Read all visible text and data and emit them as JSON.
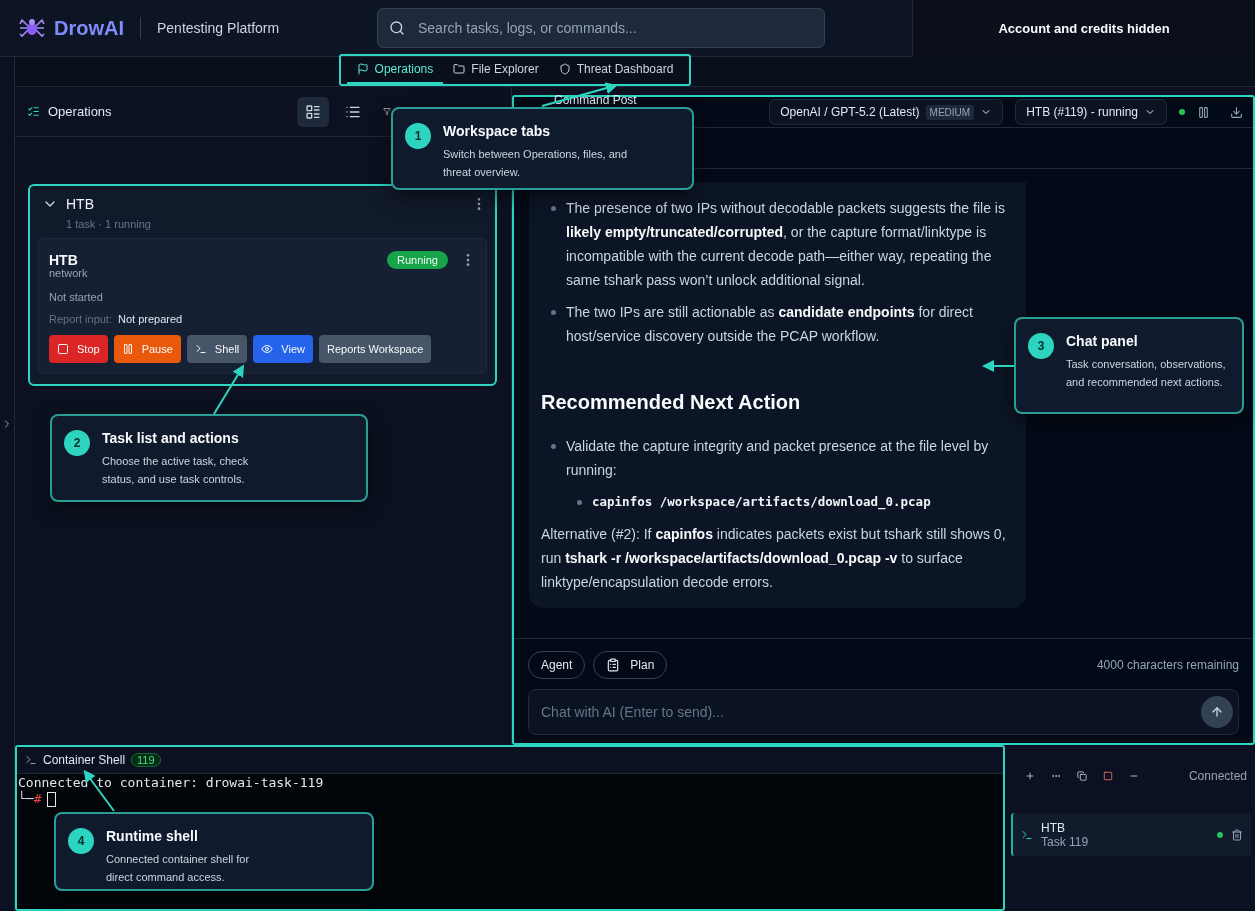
{
  "header": {
    "logo": "DrowAI",
    "subtitle": "Pentesting Platform",
    "search": {
      "placeholder": "Search tasks, logs, or commands..."
    },
    "account": "Account and credits hidden"
  },
  "tabs": [
    {
      "kind": "operations",
      "label": "Operations",
      "selected": true
    },
    {
      "kind": "files",
      "label": "File Explorer",
      "selected": false
    },
    {
      "kind": "threats",
      "label": "Threat Dashboard",
      "selected": false
    }
  ],
  "operations": {
    "title": "Operations",
    "views": [
      {
        "kind": "cards",
        "selected": true
      },
      {
        "kind": "list",
        "selected": false
      }
    ],
    "groups": [
      {
        "name": "HTB",
        "expanded": true,
        "summary": "1 task · 1 running",
        "tasks": [
          {
            "name": "HTB",
            "type": "network",
            "status": "Running",
            "progress": "Not started",
            "report_label": "Report input:",
            "report_value": "Not prepared",
            "actions": [
              {
                "kind": "stop",
                "label": "Stop"
              },
              {
                "kind": "pause",
                "label": "Pause"
              },
              {
                "kind": "shell",
                "label": "Shell"
              },
              {
                "kind": "view",
                "label": "View"
              },
              {
                "kind": "reports",
                "label": "Reports Workspace"
              }
            ]
          }
        ]
      }
    ]
  },
  "chat": {
    "title": "Command Post",
    "model": "OpenAI / GPT-5.2 (Latest)",
    "effort": "MEDIUM",
    "task_select": "HTB (#119) - running",
    "connected": true,
    "blocks": [
      {
        "kind": "bullet",
        "text": "The presence of two IPs without decodable packets suggests the file is **likely empty/truncated/corrupted**, or the capture format/linktype is incompatible with the current decode path—either way, repeating the same tshark pass won’t unlock additional signal."
      },
      {
        "kind": "bullet",
        "text": "The two IPs are still actionable as **candidate endpoints** for direct host/service discovery outside the PCAP workflow."
      },
      {
        "kind": "heading",
        "text": "Recommended Next Action"
      },
      {
        "kind": "bullet",
        "text": "Validate the capture integrity and packet presence at the file level by running:"
      },
      {
        "kind": "code_bullet",
        "text": "capinfos /workspace/artifacts/download_0.pcap"
      },
      {
        "kind": "paragraph",
        "text": "Alternative (#2): If **capinfos** indicates packets exist but tshark still shows 0, run **tshark -r /workspace/artifacts/download_0.pcap -v** to surface linktype/encapsulation decode errors."
      }
    ],
    "modes": [
      {
        "kind": "agent",
        "label": "Agent"
      },
      {
        "kind": "plan",
        "label": "Plan"
      }
    ],
    "remaining": "4000 characters remaining",
    "input": {
      "placeholder": "Chat with AI (Enter to send)..."
    }
  },
  "shell": {
    "title": "Container Shell",
    "badge": "119",
    "lines": [
      "Connected to container: drowai-task-119"
    ],
    "prompt": "└─#",
    "status": "Connected",
    "sessions": [
      {
        "name": "HTB",
        "detail": "Task 119",
        "selected": true,
        "connected": true
      }
    ]
  },
  "callouts": [
    {
      "number": "1",
      "title": "Workspace tabs",
      "text": "Switch between Operations, files, and threat overview."
    },
    {
      "number": "2",
      "title": "Task list and actions",
      "text": "Choose the active task, check status, and use task controls."
    },
    {
      "number": "3",
      "title": "Chat panel",
      "text": "Task conversation, observations, and recommended next actions."
    },
    {
      "number": "4",
      "title": "Runtime shell",
      "text": "Connected container shell for direct command access."
    }
  ]
}
